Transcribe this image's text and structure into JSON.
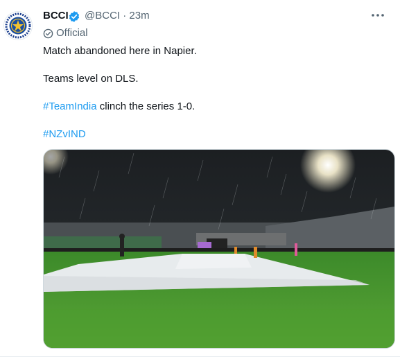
{
  "tweet": {
    "author_name": "BCCI",
    "handle": "@BCCI",
    "separator": "·",
    "time": "23m",
    "official_label": "Official",
    "lines": {
      "line1": "Match abandoned here in Napier.",
      "line2": "Teams level on DLS.",
      "line3_tag": "#TeamIndia",
      "line3_rest": " clinch the series 1-0.",
      "line4_tag": "#NZvIND"
    },
    "icons": {
      "verified": "verified-badge-icon",
      "official": "official-check-icon",
      "more": "more-options-icon",
      "avatar": "bcci-logo"
    },
    "colors": {
      "link": "#1d9bf0",
      "verified": "#1d9bf0",
      "muted": "#536471"
    }
  }
}
